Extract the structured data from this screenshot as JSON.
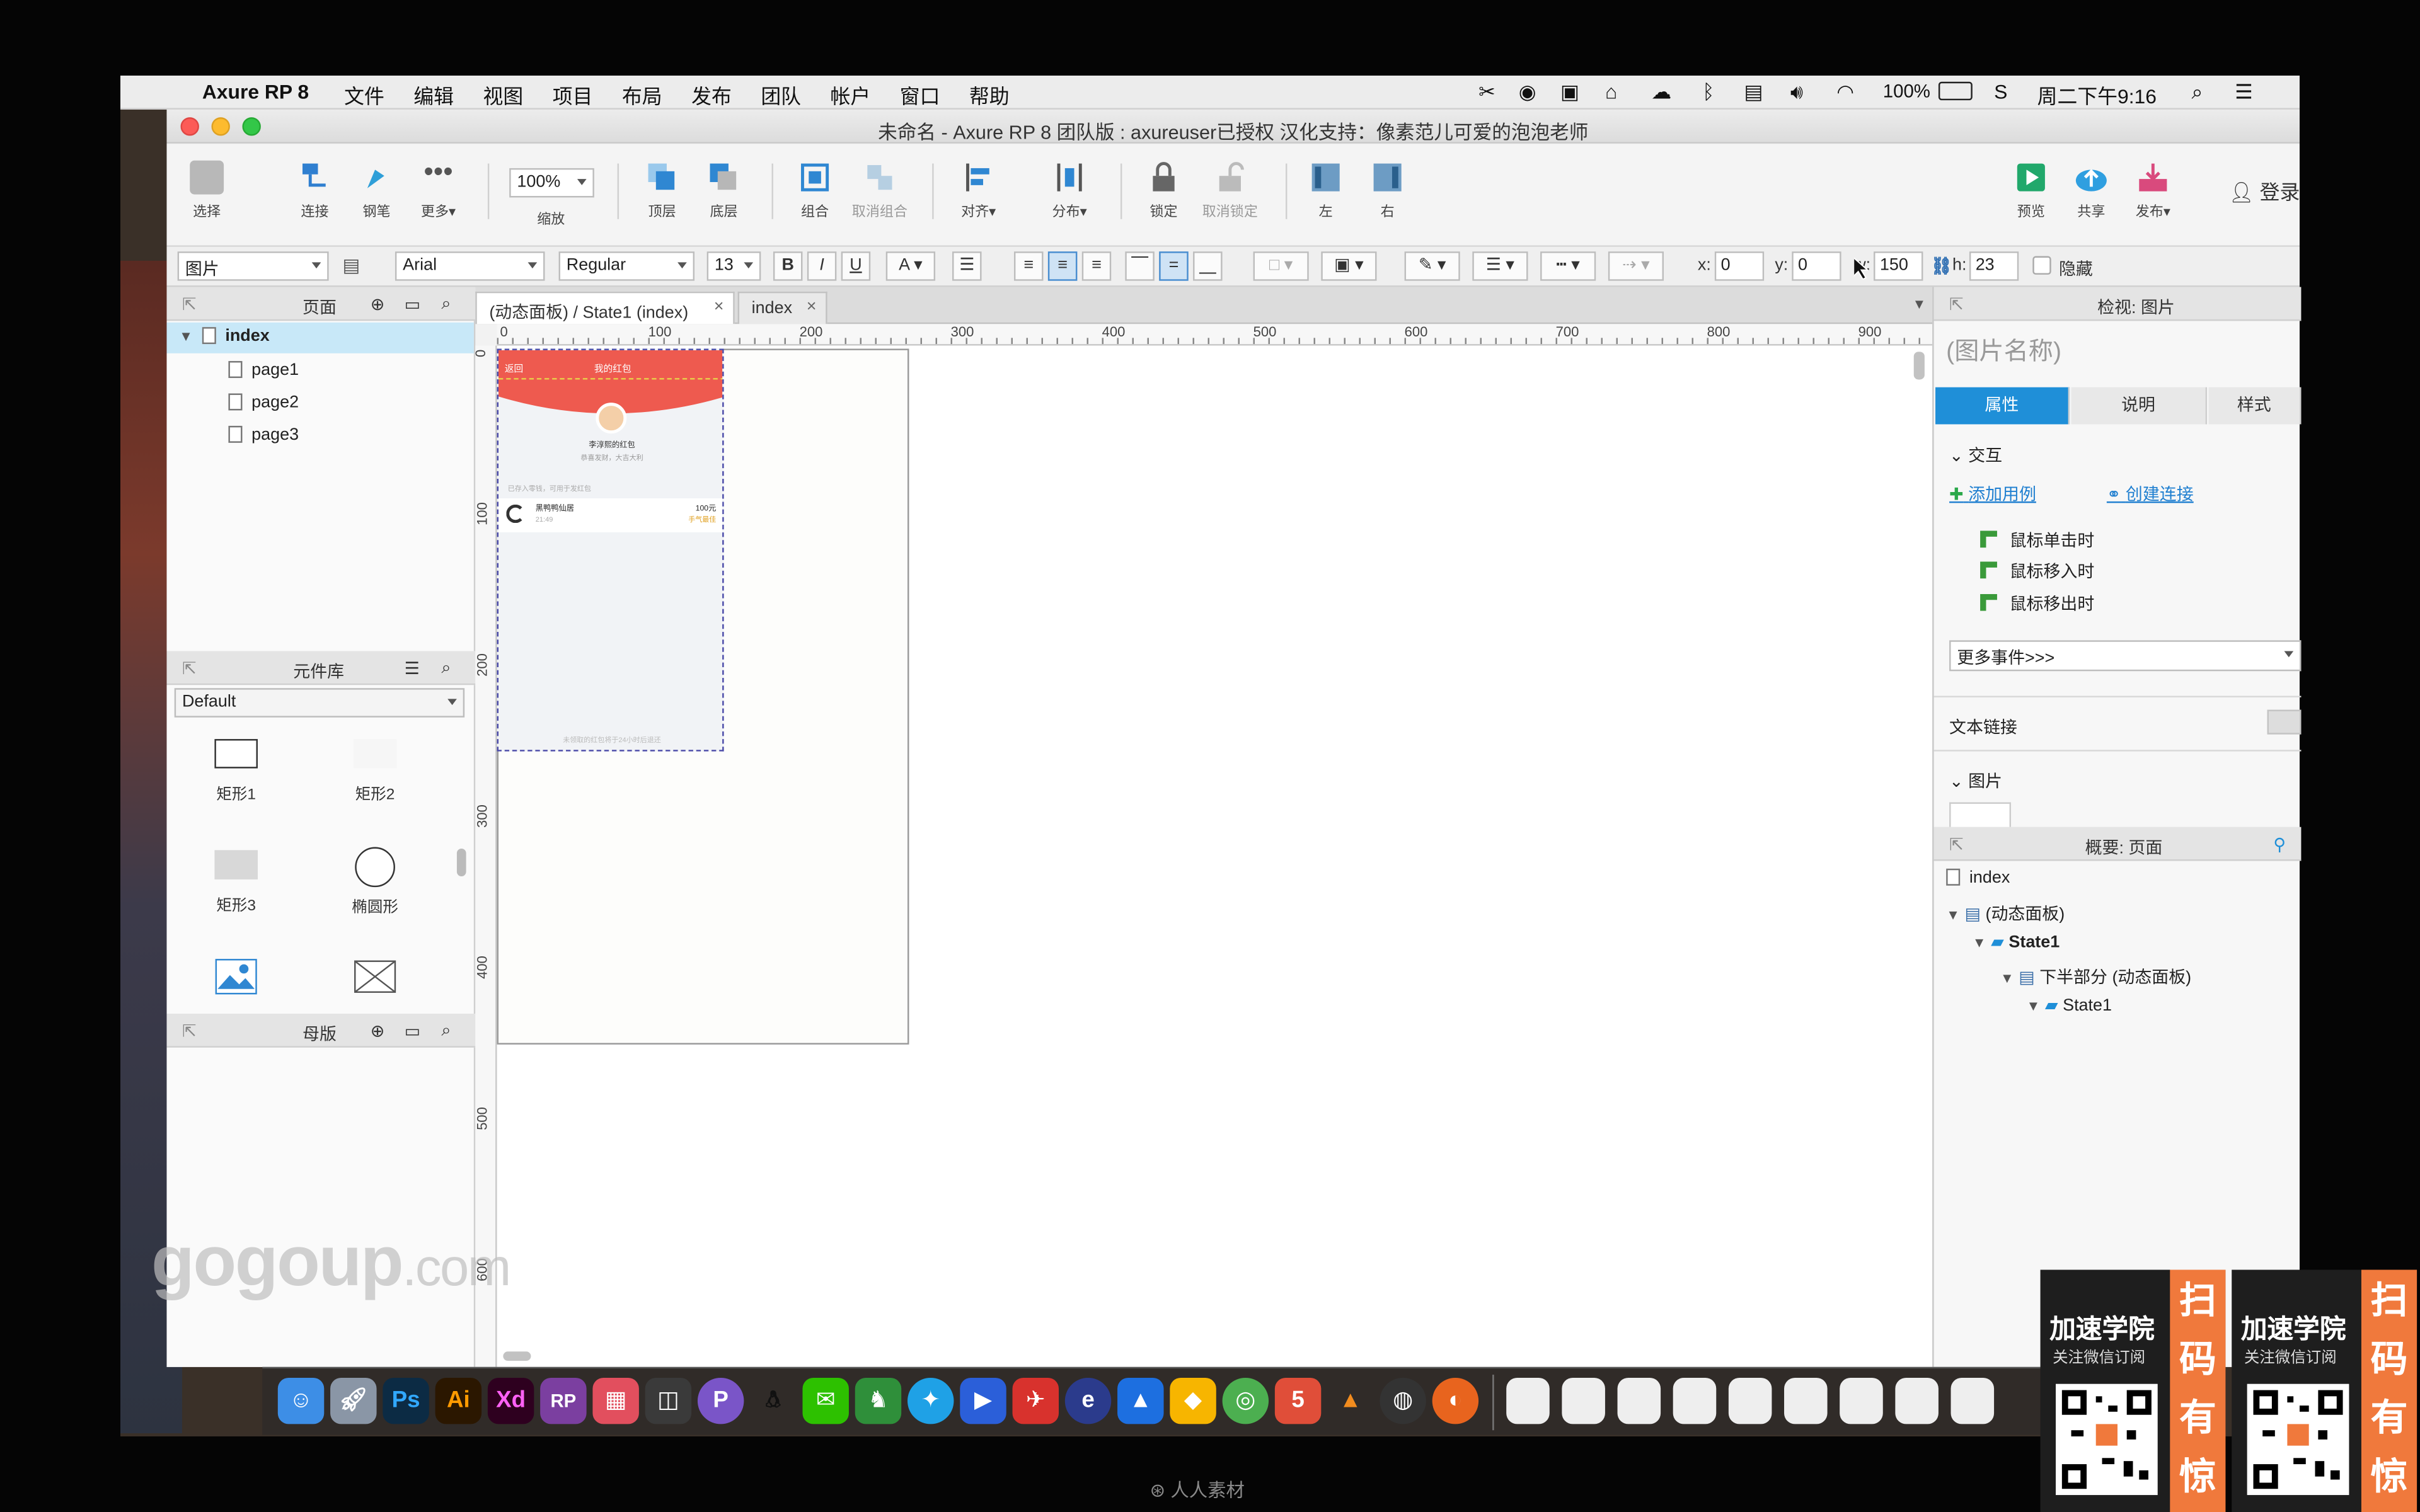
{
  "menubar": {
    "app": "Axure RP 8",
    "items": [
      "文件",
      "编辑",
      "视图",
      "项目",
      "布局",
      "发布",
      "团队",
      "帐户",
      "窗口",
      "帮助"
    ],
    "battery": "100%",
    "clock": "周二下午9:16"
  },
  "window": {
    "title": "未命名 - Axure RP 8 团队版 : axureuser已授权 汉化支持：像素范儿可爱的泡泡老师"
  },
  "toolbar": {
    "select": "选择",
    "connect": "连接",
    "pen": "钢笔",
    "more": "更多▾",
    "zoom_value": "100%",
    "zoom_label": "缩放",
    "top": "顶层",
    "bottom": "底层",
    "group": "组合",
    "ungroup": "取消组合",
    "align": "对齐▾",
    "distribute": "分布▾",
    "lock": "锁定",
    "unlock": "取消锁定",
    "left": "左",
    "right": "右",
    "preview": "预览",
    "share": "共享",
    "publish": "发布▾",
    "login": "登录"
  },
  "format": {
    "widget_type": "图片",
    "font": "Arial",
    "weight": "Regular",
    "size": "13",
    "x_label": "x:",
    "x": "0",
    "y_label": "y:",
    "y": "0",
    "w_label": "w:",
    "w": "150",
    "h_label": "h:",
    "h": "23",
    "hidden": "隐藏"
  },
  "pages_panel": {
    "title": "页面",
    "items": [
      "index",
      "page1",
      "page2",
      "page3"
    ]
  },
  "library_panel": {
    "title": "元件库",
    "library": "Default",
    "widgets": [
      "矩形1",
      "矩形2",
      "矩形3",
      "椭圆形"
    ]
  },
  "masters_panel": {
    "title": "母版"
  },
  "tabs": [
    {
      "label": "(动态面板) / State1 (index)"
    },
    {
      "label": "index"
    }
  ],
  "ruler_h": [
    "0",
    "100",
    "200",
    "300",
    "400",
    "500",
    "600",
    "700",
    "800",
    "900"
  ],
  "ruler_v": [
    "0",
    "100",
    "200",
    "300",
    "400",
    "500",
    "600"
  ],
  "phone": {
    "back": "返回",
    "header": "我的红包",
    "name": "李淳熙的红包",
    "subtitle": "恭喜发财，大吉大利",
    "section": "已存入零钱，可用于发红包",
    "row_title": "黑鸭鸭仙居",
    "row_time": "21:49",
    "row_amount": "100元",
    "row_badge": "手气最佳",
    "footer": "未领取的红包将于24小时后退还"
  },
  "inspector": {
    "title": "检视: 图片",
    "name_placeholder": "(图片名称)",
    "tab_props": "属性",
    "tab_notes": "说明",
    "tab_style": "样式",
    "interactions": "交互",
    "add_case": "添加用例",
    "create_link": "创建连接",
    "events": [
      "鼠标单击时",
      "鼠标移入时",
      "鼠标移出时"
    ],
    "more_events": "更多事件>>>",
    "text_link": "文本链接",
    "image": "图片"
  },
  "outline": {
    "title": "概要: 页面",
    "items": [
      "index",
      "(动态面板)",
      "State1",
      "下半部分 (动态面板)",
      "State1"
    ]
  },
  "dock": [
    "Ps",
    "Ai",
    "Xd",
    "RP"
  ],
  "watermark": {
    "main": "gogoup",
    "suffix": ".com"
  },
  "ads": [
    {
      "title": "加速学院",
      "sub": "关注微信订阅",
      "strip": "扫码有惊喜"
    },
    {
      "title": "加速学院",
      "sub": "关注微信订阅",
      "strip": "扫码有惊喜"
    }
  ],
  "footer_watermark": "人人素材",
  "colors": {
    "accent": "#1f8fd8",
    "selection": "#c8e8f8",
    "phone_red": "#ee5a4f",
    "ad_orange": "#f0793c"
  }
}
